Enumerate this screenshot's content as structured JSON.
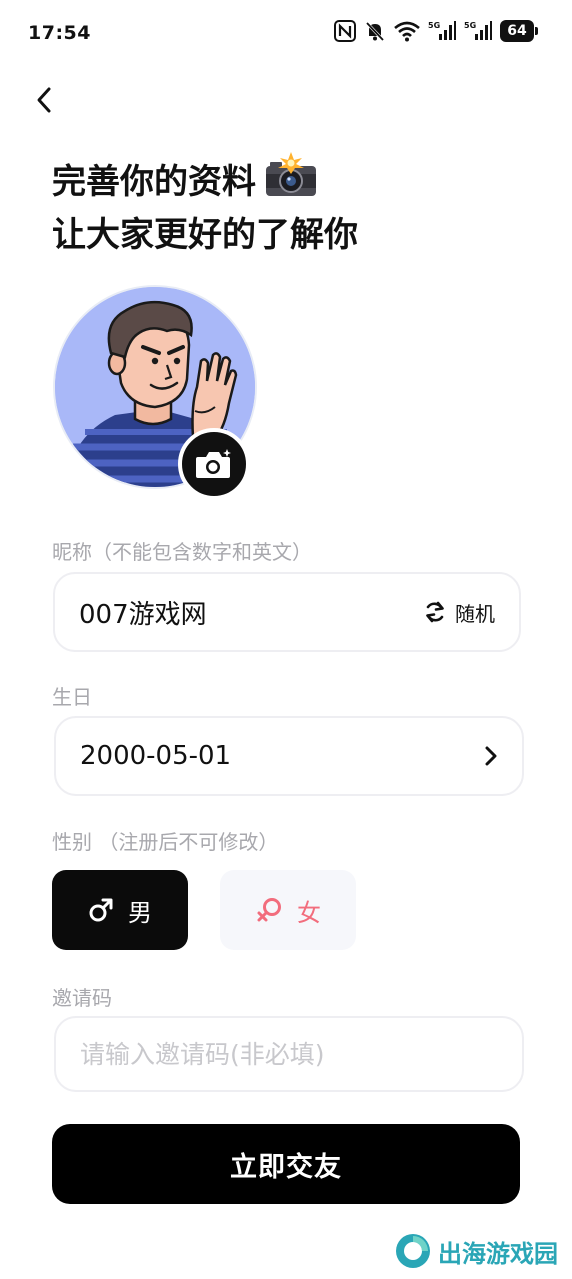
{
  "status_bar": {
    "time": "17:54",
    "battery": "64",
    "icons": [
      "nfc-icon",
      "bell-muted-icon",
      "wifi-icon",
      "signal-5g-icon",
      "signal-5g-icon",
      "battery-icon"
    ]
  },
  "header": {
    "back_icon": "chevron-left-icon",
    "title_line1": "完善你的资料",
    "title_emoji_icon": "camera-flash-icon",
    "title_line2": "让大家更好的了解你"
  },
  "avatar": {
    "edit_icon": "camera-icon"
  },
  "nickname": {
    "label": "昵称（不能包含数字和英文）",
    "value": "007游戏网",
    "random_label": "随机",
    "random_icon": "refresh-icon"
  },
  "birthday": {
    "label": "生日",
    "value": "2000-05-01",
    "arrow_icon": "chevron-right-icon"
  },
  "gender": {
    "label": "性别 （注册后不可修改）",
    "male_label": "男",
    "female_label": "女",
    "selected": "男",
    "male_icon": "male-symbol-icon",
    "female_icon": "female-symbol-icon"
  },
  "invite": {
    "label": "邀请码",
    "placeholder": "请输入邀请码(非必填)",
    "value": ""
  },
  "submit": {
    "label": "立即交友"
  },
  "watermark": {
    "text": "出海游戏园"
  },
  "colors": {
    "accent_black": "#000000",
    "female_pink": "#f26d7d",
    "avatar_bg": "#a9b8f8",
    "watermark_teal": "#2aa6b6",
    "label_gray": "#a8a8ad"
  }
}
